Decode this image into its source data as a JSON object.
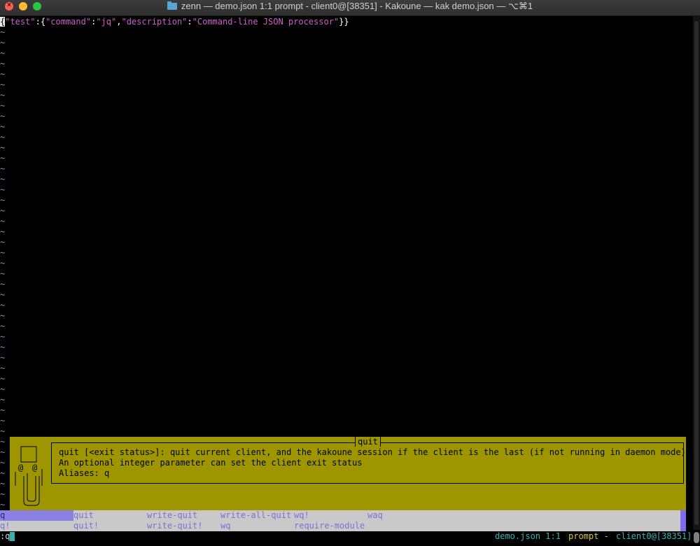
{
  "window": {
    "title": "zenn — demo.json 1:1  prompt - client0@[38351] - Kakoune — kak demo.json — ⌥⌘1",
    "close_glyph": "×"
  },
  "buffer": {
    "json_tokens": [
      "{",
      "\"test\"",
      ":",
      "{",
      "\"command\"",
      ":",
      "\"jq\"",
      ",",
      "\"description\"",
      ":",
      "\"Command-line JSON processor\"",
      "}}"
    ],
    "empty_line_marker": "~",
    "empty_line_count": 46
  },
  "info": {
    "title": "quit",
    "lines": [
      "quit [<exit status>]: quit current client, and the kakoune session if the client is the last (if not running in daemon mode).",
      "An optional integer parameter can set the client exit status",
      "Aliases: q"
    ]
  },
  "completion": {
    "rows": [
      [
        "q",
        "quit",
        "write-quit",
        "write-all-quit",
        "wq!",
        "waq"
      ],
      [
        "q!",
        "quit!",
        "write-quit!",
        "wq",
        "require-module",
        ""
      ]
    ],
    "selected": "q"
  },
  "status": {
    "prompt": ":q",
    "file": "demo.json 1:1",
    "mode": "prompt",
    "client": "client0@[38351]",
    "sep": " - "
  },
  "colors": {
    "info_background": "#9e9600",
    "menu_background": "#c9c9c9",
    "menu_selected": "#8b80e4",
    "json_string": "#cf5ccf",
    "tilde": "#7a9aab"
  }
}
